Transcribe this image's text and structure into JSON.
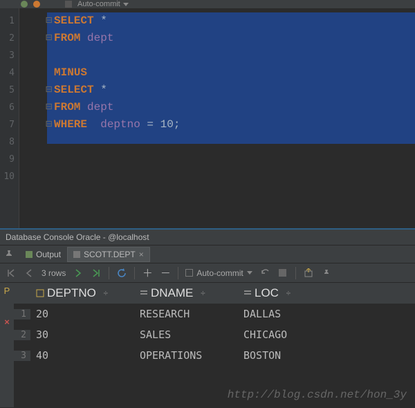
{
  "top_toolbar": {
    "auto_commit_label": "Auto-commit"
  },
  "editor": {
    "line_count": 10,
    "code_tokens": [
      [
        {
          "t": "kw",
          "v": "SELECT"
        },
        {
          "t": "op",
          "v": " *"
        }
      ],
      [
        {
          "t": "kw",
          "v": "FROM"
        },
        {
          "t": "op",
          "v": " "
        },
        {
          "t": "id",
          "v": "dept"
        }
      ],
      [],
      [
        {
          "t": "kw",
          "v": "MINUS"
        }
      ],
      [
        {
          "t": "kw",
          "v": "SELECT"
        },
        {
          "t": "op",
          "v": " *"
        }
      ],
      [
        {
          "t": "kw",
          "v": "FROM"
        },
        {
          "t": "op",
          "v": " "
        },
        {
          "t": "id",
          "v": "dept"
        }
      ],
      [
        {
          "t": "kw",
          "v": "WHERE"
        },
        {
          "t": "op",
          "v": "  "
        },
        {
          "t": "id",
          "v": "deptno"
        },
        {
          "t": "op",
          "v": " = 10"
        },
        {
          "t": "op",
          "v": ";"
        }
      ],
      [],
      [],
      []
    ]
  },
  "panel_title": "Database Console Oracle - @localhost",
  "panel_tabs": [
    {
      "label": "Output",
      "closable": false,
      "active": false
    },
    {
      "label": "SCOTT.DEPT",
      "closable": true,
      "active": true
    }
  ],
  "results_toolbar": {
    "rows_label": "3 rows",
    "auto_commit_label": "Auto-commit"
  },
  "results": {
    "columns": [
      "DEPTNO",
      "DNAME",
      "LOC"
    ],
    "rows": [
      {
        "n": "1",
        "DEPTNO": "20",
        "DNAME": "RESEARCH",
        "LOC": "DALLAS"
      },
      {
        "n": "2",
        "DEPTNO": "30",
        "DNAME": "SALES",
        "LOC": "CHICAGO"
      },
      {
        "n": "3",
        "DEPTNO": "40",
        "DNAME": "OPERATIONS",
        "LOC": "BOSTON"
      }
    ]
  },
  "watermark": "http://blog.csdn.net/hon_3y"
}
